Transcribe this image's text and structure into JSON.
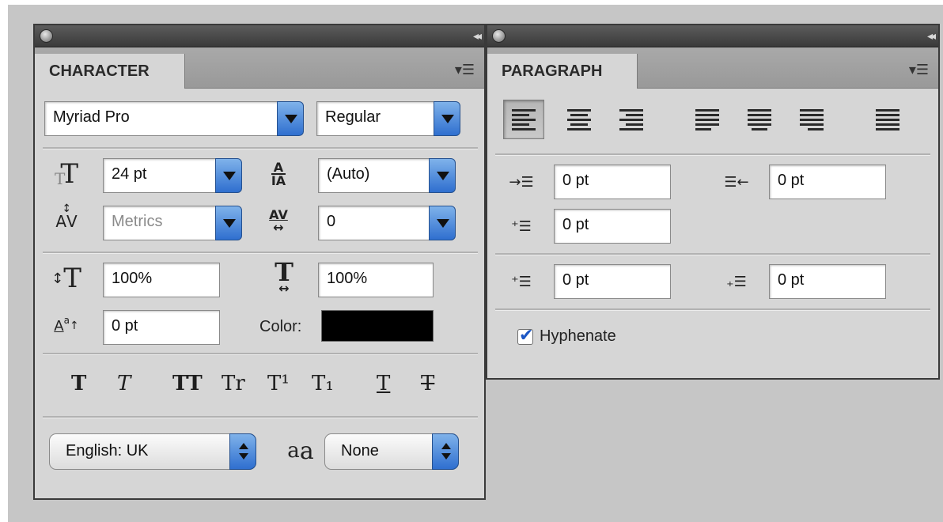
{
  "character": {
    "tab_label": "CHARACTER",
    "font_family": "Myriad Pro",
    "font_style": "Regular",
    "font_size": "24 pt",
    "leading": "(Auto)",
    "kerning": "Metrics",
    "tracking": "0",
    "vertical_scale": "100%",
    "horizontal_scale": "100%",
    "baseline_shift": "0 pt",
    "color_label": "Color:",
    "color_value": "#000000",
    "style_buttons": [
      "T",
      "T",
      "TT",
      "Tr",
      "T¹",
      "T₁",
      "T",
      "T"
    ],
    "language": "English: UK",
    "antialias": "None"
  },
  "paragraph": {
    "tab_label": "PARAGRAPH",
    "indent_left": "0 pt",
    "indent_right": "0 pt",
    "indent_first_line": "0 pt",
    "space_before": "0 pt",
    "space_after": "0 pt",
    "hyphenate_label": "Hyphenate",
    "hyphenate_checked": true
  },
  "icons": {
    "close": "close-dot-icon",
    "collapse": "double-chevron-left-icon",
    "panel_menu": "panel-menu-icon"
  }
}
